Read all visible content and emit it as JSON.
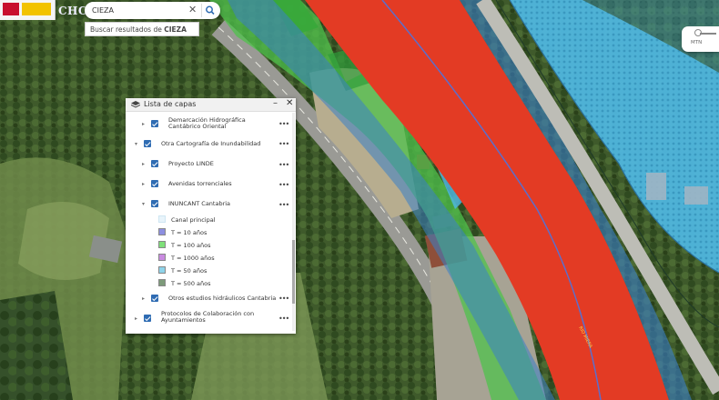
{
  "app": {
    "brand": "CHC"
  },
  "search": {
    "value": "CIEZA",
    "placeholder": "",
    "suggestion_prefix": "Buscar resultados de ",
    "suggestion_term": "CIEZA"
  },
  "mtn": {
    "label": "MTN"
  },
  "map": {
    "river_label": "RÍO MIERA"
  },
  "layers_panel": {
    "title": "Lista de capas",
    "items": [
      {
        "label": "Demarcación Hidrográfica Cantábrico Oriental",
        "line1": "Demarcación Hidrográfica",
        "line2": "Cantábrico Oriental",
        "checked": true
      },
      {
        "label": "Otra Cartografía de Inundabilidad",
        "checked": true
      },
      {
        "label": "Proyecto LINDE",
        "checked": true
      },
      {
        "label": "Avenidas torrenciales",
        "checked": true
      },
      {
        "label": "INUNCANT Cantabria",
        "checked": true
      },
      {
        "label": "Otros estudios hidráulicos Cantabria",
        "checked": true
      },
      {
        "label": "Protocolos de Colaboración con Ayuntamientos",
        "line1": "Protocolos de Colaboración con",
        "line2": "Ayuntamientos",
        "checked": true
      }
    ],
    "legend": [
      {
        "label": "Canal principal",
        "color": "#e8f4fb"
      },
      {
        "label": "T = 10 años",
        "color": "#8d8fe0"
      },
      {
        "label": "T = 100 años",
        "color": "#7fe07a"
      },
      {
        "label": "T = 1000 años",
        "color": "#c98be0"
      },
      {
        "label": "T = 50 años",
        "color": "#8fd4ea"
      },
      {
        "label": "T = 500 años",
        "color": "#7d9a7a"
      }
    ]
  },
  "colors": {
    "flood_red": "#e33b24",
    "checkbox": "#2f6cb3",
    "water_blue": "#3aa3d8"
  }
}
